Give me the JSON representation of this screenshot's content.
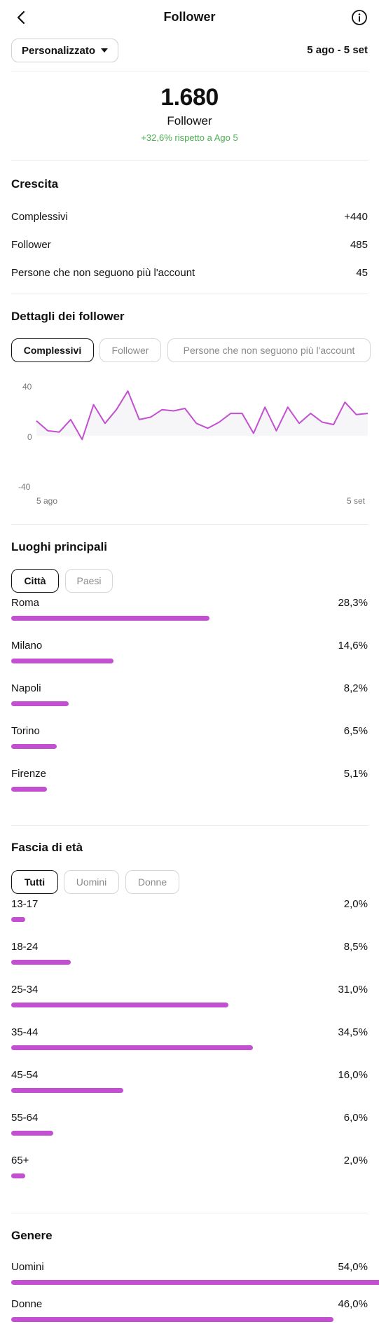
{
  "header": {
    "title": "Follower",
    "back_icon": "chevron-left-icon",
    "info_icon": "info-icon"
  },
  "range": {
    "select_label": "Personalizzato",
    "dates": "5 ago - 5 set"
  },
  "summary": {
    "value": "1.680",
    "label": "Follower",
    "delta": "+32,6% rispetto a Ago 5",
    "delta_color": "#4caf50"
  },
  "growth": {
    "title": "Crescita",
    "rows": [
      {
        "label": "Complessivi",
        "value": "+440"
      },
      {
        "label": "Follower",
        "value": "485"
      },
      {
        "label": "Persone che non seguono più l'account",
        "value": "45"
      }
    ]
  },
  "details": {
    "title": "Dettagli dei follower",
    "tabs": [
      "Complessivi",
      "Follower",
      "Persone che non seguono più l'account"
    ],
    "active_tab": 0
  },
  "chart_data": {
    "type": "line",
    "title": "",
    "xlabel": "",
    "ylabel": "",
    "ylim": [
      -40,
      40
    ],
    "y_ticks": [
      "40",
      "0",
      "-40"
    ],
    "x_tick_labels": [
      "5 ago",
      "5 set"
    ],
    "grid": false,
    "color": "#c34fd1",
    "series": [
      {
        "values": [
          12,
          4,
          3,
          13,
          -3,
          25,
          10,
          21,
          36,
          13,
          15,
          21,
          20,
          22,
          10,
          6,
          11,
          18,
          18,
          2,
          23,
          4,
          23,
          10,
          18,
          11,
          9,
          27,
          17,
          18
        ]
      }
    ]
  },
  "places": {
    "title": "Luoghi principali",
    "tabs": [
      "Città",
      "Paesi"
    ],
    "active_tab": 0,
    "items": [
      {
        "label": "Roma",
        "value": "28,3%",
        "fraction": 0.283
      },
      {
        "label": "Milano",
        "value": "14,6%",
        "fraction": 0.146
      },
      {
        "label": "Napoli",
        "value": "8,2%",
        "fraction": 0.082
      },
      {
        "label": "Torino",
        "value": "6,5%",
        "fraction": 0.065
      },
      {
        "label": "Firenze",
        "value": "5,1%",
        "fraction": 0.051
      }
    ]
  },
  "age": {
    "title": "Fascia di età",
    "tabs": [
      "Tutti",
      "Uomini",
      "Donne"
    ],
    "active_tab": 0,
    "items": [
      {
        "label": "13-17",
        "value": "2,0%",
        "fraction": 0.02
      },
      {
        "label": "18-24",
        "value": "8,5%",
        "fraction": 0.085
      },
      {
        "label": "25-34",
        "value": "31,0%",
        "fraction": 0.31
      },
      {
        "label": "35-44",
        "value": "34,5%",
        "fraction": 0.345
      },
      {
        "label": "45-54",
        "value": "16,0%",
        "fraction": 0.16
      },
      {
        "label": "55-64",
        "value": "6,0%",
        "fraction": 0.06
      },
      {
        "label": "65+",
        "value": "2,0%",
        "fraction": 0.02
      }
    ]
  },
  "gender": {
    "title": "Genere",
    "items": [
      {
        "label": "Uomini",
        "value": "54,0%",
        "fraction": 0.54
      },
      {
        "label": "Donne",
        "value": "46,0%",
        "fraction": 0.46
      }
    ]
  },
  "colors": {
    "accent": "#c34fd1",
    "positive": "#4caf50"
  }
}
